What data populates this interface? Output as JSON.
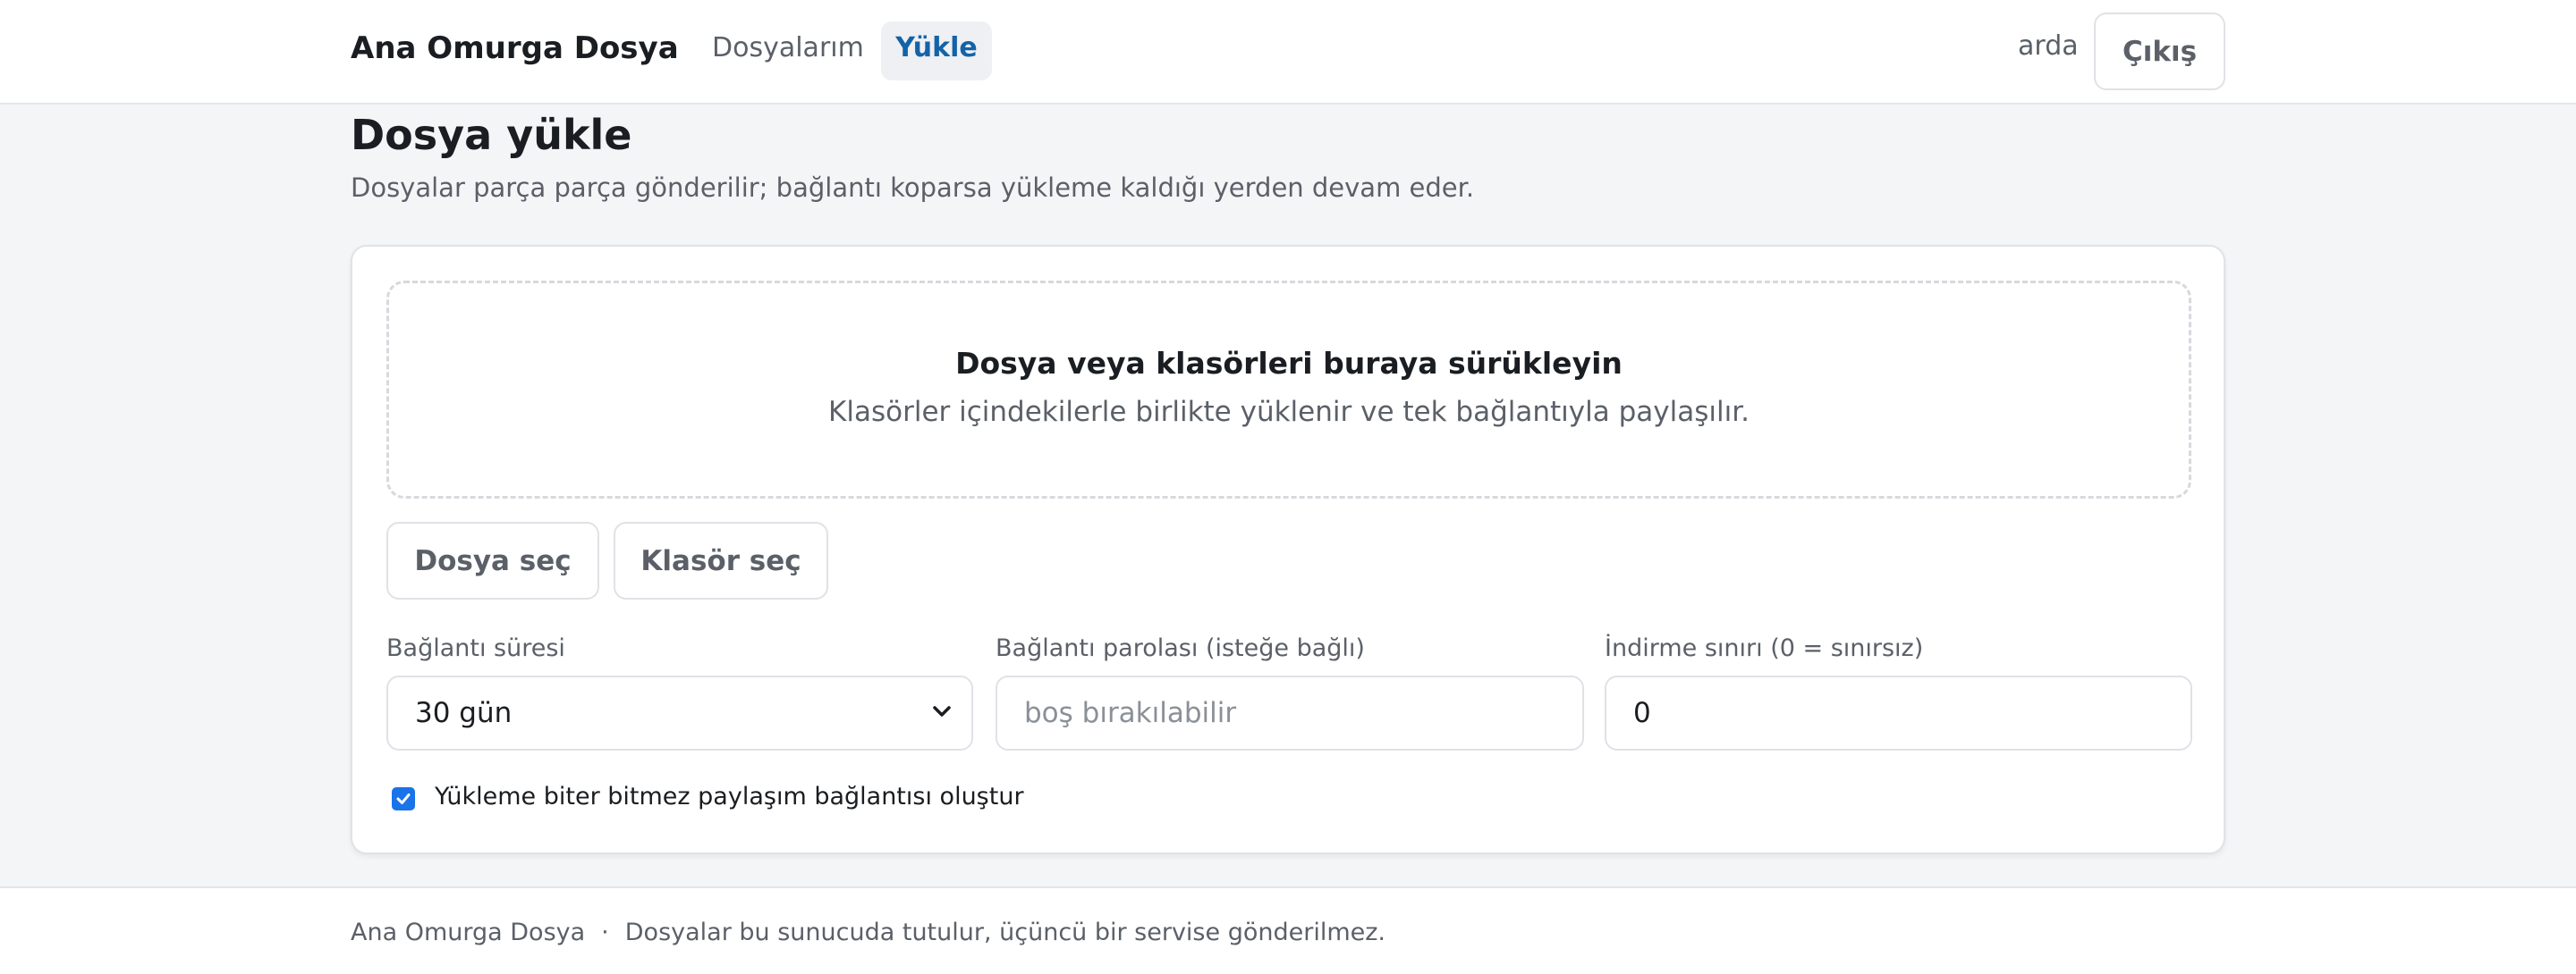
{
  "header": {
    "brand": "Ana Omurga Dosya",
    "nav": [
      {
        "label": "Dosyalarım"
      },
      {
        "label": "Yükle"
      }
    ],
    "user": "arda",
    "logout_label": "Çıkış"
  },
  "main": {
    "title": "Dosya yükle",
    "subtitle": "Dosyalar parça parça gönderilir; bağlantı koparsa yükleme kaldığı yerden devam eder.",
    "dropzone": {
      "title": "Dosya veya klasörleri buraya sürükleyin",
      "subtitle": "Klasörler içindekilerle birlikte yüklenir ve tek bağlantıyla paylaşılır."
    },
    "buttons": {
      "choose_file": "Dosya seç",
      "choose_folder": "Klasör seç"
    },
    "fields": {
      "duration": {
        "label": "Bağlantı süresi",
        "value": "30 gün"
      },
      "password": {
        "label": "Bağlantı parolası (isteğe bağlı)",
        "value": "",
        "placeholder": "boş bırakılabilir"
      },
      "limit": {
        "label": "İndirme sınırı (0 = sınırsız)",
        "value": "0"
      }
    },
    "auto_share": {
      "label": "Yükleme biter bitmez paylaşım bağlantısı oluştur",
      "checked": true
    }
  },
  "footer": {
    "brand": "Ana Omurga Dosya",
    "separator": "·",
    "note": "Dosyalar bu sunucuda tutulur, üçüncü bir servise gönderilmez."
  },
  "colors": {
    "accent": "#1463a8",
    "checkbox": "#1a73e8",
    "background": "#f4f5f7"
  }
}
